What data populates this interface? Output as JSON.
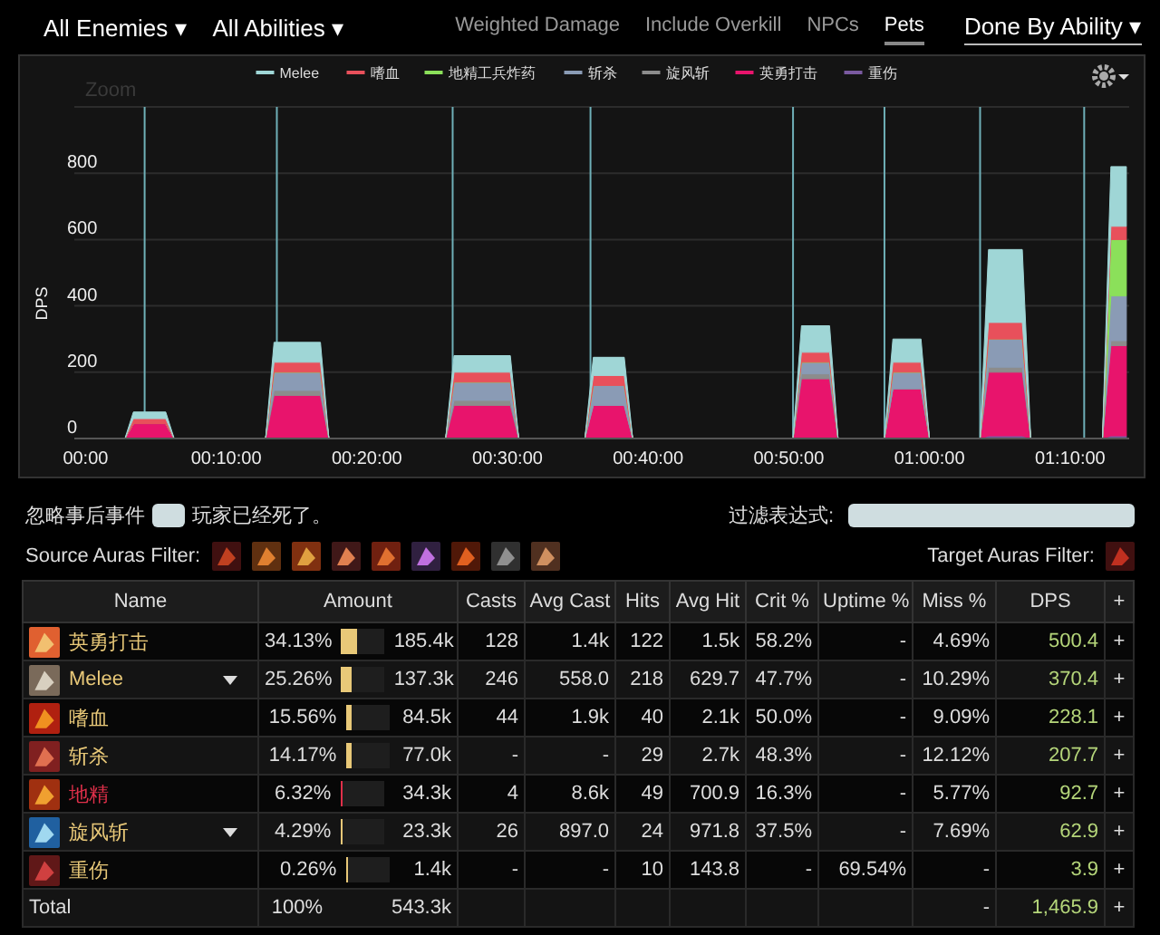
{
  "top_bar": {
    "filters": [
      {
        "label": "All Enemies",
        "caret": "▾"
      },
      {
        "label": "All Abilities",
        "caret": "▾"
      }
    ],
    "toggles": [
      {
        "label": "Weighted Damage",
        "selected": false
      },
      {
        "label": "Include Overkill",
        "selected": false
      },
      {
        "label": "NPCs",
        "selected": false
      },
      {
        "label": "Pets",
        "selected": true
      }
    ],
    "view": {
      "label": "Done By Ability",
      "caret": "▾"
    }
  },
  "chart": {
    "zoom_label": "Zoom",
    "chart_data": {
      "type": "area",
      "stacked": true,
      "ylabel": "DPS",
      "grid": true,
      "legend": "top",
      "ref_lines": [
        {
          "axis": "x",
          "value": 4.2,
          "color": "#6fb0b8"
        },
        {
          "axis": "x",
          "value": 13.6,
          "color": "#6fb0b8"
        },
        {
          "axis": "x",
          "value": 26.1,
          "color": "#6fb0b8"
        },
        {
          "axis": "x",
          "value": 35.9,
          "color": "#6fb0b8"
        },
        {
          "axis": "x",
          "value": 50.3,
          "color": "#6fb0b8"
        },
        {
          "axis": "x",
          "value": 56.8,
          "color": "#6fb0b8"
        },
        {
          "axis": "x",
          "value": 63.6,
          "color": "#6fb0b8"
        },
        {
          "axis": "x",
          "value": 71.0,
          "color": "#6fb0b8"
        }
      ],
      "xlim": [
        -0.8,
        74.2
      ],
      "ylim": [
        0,
        1000
      ],
      "yticks": [
        0,
        200,
        400,
        600,
        800
      ],
      "xticks": [
        {
          "value": 0,
          "label": "00:00"
        },
        {
          "value": 10,
          "label": "00:10:00"
        },
        {
          "value": 20,
          "label": "00:20:00"
        },
        {
          "value": 30,
          "label": "00:30:00"
        },
        {
          "value": 40,
          "label": "00:40:00"
        },
        {
          "value": 50,
          "label": "00:50:00"
        },
        {
          "value": 60,
          "label": "01:00:00"
        },
        {
          "value": 70,
          "label": "01:10:00"
        }
      ],
      "x": [
        0,
        2.8,
        3.4,
        5.7,
        6.3,
        12.8,
        13.4,
        16.7,
        17.3,
        25.6,
        26.2,
        30.2,
        30.8,
        35.5,
        36.1,
        38.3,
        38.9,
        50.3,
        50.9,
        52.9,
        53.5,
        56.8,
        57.4,
        59.4,
        60,
        63.6,
        64.2,
        66.6,
        67.2,
        72.3,
        72.9,
        74
      ],
      "series": [
        {
          "name": "重伤",
          "color": "#7a5aa0",
          "values": [
            0,
            0,
            0,
            0,
            0,
            0,
            0,
            0,
            0,
            0,
            0,
            0,
            0,
            0,
            0,
            0,
            0,
            0,
            0,
            0,
            0,
            0,
            0,
            0,
            0,
            0,
            8,
            8,
            0,
            0,
            8,
            8
          ]
        },
        {
          "name": "英勇打击",
          "color": "#e8146c",
          "values": [
            0,
            0,
            45,
            45,
            0,
            0,
            130,
            130,
            0,
            0,
            100,
            100,
            0,
            0,
            100,
            100,
            0,
            0,
            180,
            180,
            0,
            0,
            150,
            150,
            0,
            0,
            192,
            192,
            0,
            0,
            272,
            272
          ]
        },
        {
          "name": "旋风斩",
          "color": "#8c8c8c",
          "values": [
            0,
            0,
            0,
            0,
            0,
            0,
            15,
            15,
            0,
            0,
            15,
            15,
            0,
            0,
            0,
            0,
            0,
            0,
            15,
            15,
            0,
            0,
            0,
            0,
            0,
            0,
            15,
            15,
            0,
            0,
            15,
            15
          ]
        },
        {
          "name": "斩杀",
          "color": "#8a9bb5",
          "values": [
            0,
            0,
            0,
            0,
            0,
            0,
            55,
            55,
            0,
            0,
            55,
            55,
            0,
            0,
            60,
            60,
            0,
            0,
            35,
            35,
            0,
            0,
            50,
            50,
            0,
            0,
            85,
            85,
            0,
            0,
            135,
            135
          ]
        },
        {
          "name": "地精工兵炸药",
          "color": "#8be05a",
          "values": [
            0,
            0,
            0,
            0,
            0,
            0,
            0,
            0,
            0,
            0,
            0,
            0,
            0,
            0,
            0,
            0,
            0,
            0,
            0,
            0,
            0,
            0,
            0,
            0,
            0,
            0,
            0,
            0,
            0,
            0,
            170,
            170
          ]
        },
        {
          "name": "嗜血",
          "color": "#e8505b",
          "values": [
            0,
            0,
            15,
            15,
            0,
            0,
            30,
            30,
            0,
            0,
            30,
            30,
            0,
            0,
            30,
            30,
            0,
            0,
            30,
            30,
            0,
            0,
            30,
            30,
            0,
            0,
            50,
            50,
            0,
            0,
            40,
            40
          ]
        },
        {
          "name": "Melee",
          "color": "#9fd6d6",
          "values": [
            0,
            0,
            20,
            20,
            0,
            0,
            60,
            60,
            0,
            0,
            50,
            50,
            0,
            0,
            55,
            55,
            0,
            0,
            80,
            80,
            0,
            0,
            70,
            70,
            0,
            0,
            220,
            220,
            0,
            0,
            180,
            180
          ]
        }
      ]
    }
  },
  "options": {
    "ignore_before": "忽略事后事件",
    "ignore_after": "玩家已经死了。",
    "filter_label": "过滤表达式:"
  },
  "auras": {
    "source_label": "Source Auras Filter:",
    "target_label": "Target Auras Filter:"
  },
  "table": {
    "columns": [
      "Name",
      "Amount",
      "Casts",
      "Avg Cast",
      "Hits",
      "Avg Hit",
      "Crit %",
      "Uptime %",
      "Miss %",
      "DPS",
      "+"
    ],
    "rows": [
      {
        "kind": "ability",
        "name": "英勇打击",
        "color": "#e8c878",
        "expand": false,
        "percent": "34.13%",
        "level": 0.3413,
        "amount": "185.4k",
        "casts": "128",
        "avg_cast": "1.4k",
        "hits": "122",
        "avg_hit": "1.5k",
        "crit": "58.2%",
        "uptime": "-",
        "miss": "4.69%",
        "dps": "500.4",
        "add": "+"
      },
      {
        "kind": "ability",
        "name": "Melee",
        "color": "#e8c878",
        "expand": true,
        "percent": "25.26%",
        "level": 0.2526,
        "amount": "137.3k",
        "casts": "246",
        "avg_cast": "558.0",
        "hits": "218",
        "avg_hit": "629.7",
        "crit": "47.7%",
        "uptime": "-",
        "miss": "10.29%",
        "dps": "370.4",
        "add": "+"
      },
      {
        "kind": "ability",
        "name": "嗜血",
        "color": "#e8c878",
        "expand": false,
        "percent": "15.56%",
        "level": 0.1556,
        "amount": "84.5k",
        "casts": "44",
        "avg_cast": "1.9k",
        "hits": "40",
        "avg_hit": "2.1k",
        "crit": "50.0%",
        "uptime": "-",
        "miss": "9.09%",
        "dps": "228.1",
        "add": "+"
      },
      {
        "kind": "ability",
        "name": "斩杀",
        "color": "#e8c878",
        "expand": false,
        "percent": "14.17%",
        "level": 0.1417,
        "amount": "77.0k",
        "casts": "-",
        "avg_cast": "-",
        "hits": "29",
        "avg_hit": "2.7k",
        "crit": "48.3%",
        "uptime": "-",
        "miss": "12.12%",
        "dps": "207.7",
        "add": "+"
      },
      {
        "kind": "ability",
        "name": "地精",
        "color": "#e0304a",
        "expand": false,
        "percent": "6.32%",
        "level": 0.0632,
        "amount": "34.3k",
        "casts": "4",
        "avg_cast": "8.6k",
        "hits": "49",
        "avg_hit": "700.9",
        "crit": "16.3%",
        "uptime": "-",
        "miss": "5.77%",
        "dps": "92.7",
        "add": "+"
      },
      {
        "kind": "ability",
        "name": "旋风斩",
        "color": "#e8c878",
        "expand": true,
        "percent": "4.29%",
        "level": 0.0429,
        "amount": "23.3k",
        "casts": "26",
        "avg_cast": "897.0",
        "hits": "24",
        "avg_hit": "971.8",
        "crit": "37.5%",
        "uptime": "-",
        "miss": "7.69%",
        "dps": "62.9",
        "add": "+"
      },
      {
        "kind": "ability",
        "name": "重伤",
        "color": "#e8c878",
        "expand": false,
        "percent": "0.26%",
        "level": 0.0026,
        "amount": "1.4k",
        "casts": "-",
        "avg_cast": "-",
        "hits": "10",
        "avg_hit": "143.8",
        "crit": "-",
        "uptime": "69.54%",
        "miss": "-",
        "dps": "3.9",
        "add": "+"
      },
      {
        "kind": "total",
        "name": "Total",
        "percent": "100%",
        "amount": "543.3k",
        "miss": "-",
        "dps": "1,465.9",
        "add": "+"
      }
    ]
  }
}
